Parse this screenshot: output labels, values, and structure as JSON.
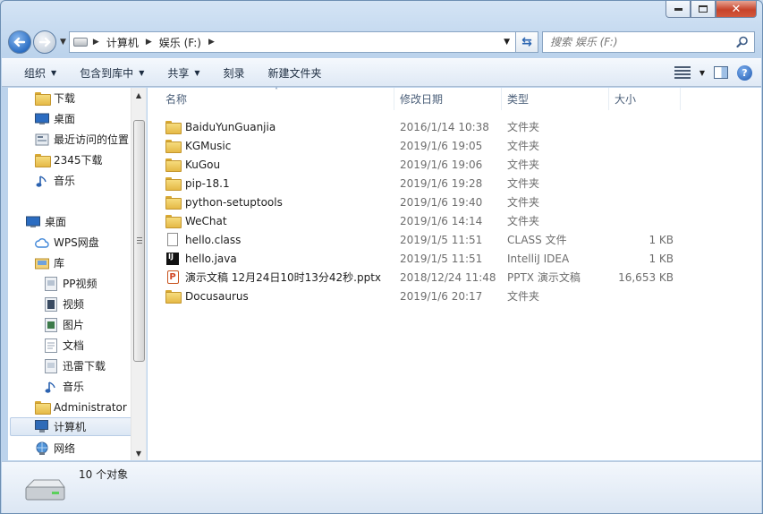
{
  "address": {
    "crumbs": [
      "计算机",
      "娱乐 (F:)"
    ],
    "search_placeholder": "搜索 娱乐 (F:)"
  },
  "toolbar": {
    "organize": "组织",
    "include_in_library": "包含到库中",
    "share": "共享",
    "burn": "刻录",
    "new_folder": "新建文件夹"
  },
  "nav": {
    "items": [
      {
        "label": "下载",
        "icon": "folder-icon"
      },
      {
        "label": "桌面",
        "icon": "desktop-icon"
      },
      {
        "label": "最近访问的位置",
        "icon": "recent-places-icon"
      },
      {
        "label": "2345下载",
        "icon": "folder-icon"
      },
      {
        "label": "音乐",
        "icon": "music-icon"
      },
      {
        "label": "桌面",
        "icon": "desktop-icon"
      },
      {
        "label": "WPS网盘",
        "icon": "cloud-icon"
      },
      {
        "label": "库",
        "icon": "library-icon"
      },
      {
        "label": "PP视频",
        "icon": "app-icon"
      },
      {
        "label": "视频",
        "icon": "video-icon"
      },
      {
        "label": "图片",
        "icon": "picture-icon"
      },
      {
        "label": "文档",
        "icon": "document-icon"
      },
      {
        "label": "迅雷下载",
        "icon": "app-icon"
      },
      {
        "label": "音乐",
        "icon": "music-icon"
      },
      {
        "label": "Administrator",
        "icon": "user-folder-icon"
      },
      {
        "label": "计算机",
        "icon": "computer-icon"
      },
      {
        "label": "网络",
        "icon": "network-icon"
      }
    ]
  },
  "columns": {
    "name": "名称",
    "date": "修改日期",
    "type": "类型",
    "size": "大小"
  },
  "files": [
    {
      "name": "BaiduYunGuanjia",
      "date": "2016/1/14 10:38",
      "type": "文件夹",
      "size": "",
      "icon": "folder-icon"
    },
    {
      "name": "KGMusic",
      "date": "2019/1/6 19:05",
      "type": "文件夹",
      "size": "",
      "icon": "folder-icon"
    },
    {
      "name": "KuGou",
      "date": "2019/1/6 19:06",
      "type": "文件夹",
      "size": "",
      "icon": "folder-icon"
    },
    {
      "name": "pip-18.1",
      "date": "2019/1/6 19:28",
      "type": "文件夹",
      "size": "",
      "icon": "folder-icon"
    },
    {
      "name": "python-setuptools",
      "date": "2019/1/6 19:40",
      "type": "文件夹",
      "size": "",
      "icon": "folder-icon"
    },
    {
      "name": "WeChat",
      "date": "2019/1/6 14:14",
      "type": "文件夹",
      "size": "",
      "icon": "folder-icon"
    },
    {
      "name": "hello.class",
      "date": "2019/1/5 11:51",
      "type": "CLASS 文件",
      "size": "1 KB",
      "icon": "file-icon"
    },
    {
      "name": "hello.java",
      "date": "2019/1/5 11:51",
      "type": "IntelliJ IDEA",
      "size": "1 KB",
      "icon": "intellij-icon"
    },
    {
      "name": "演示文稿 12月24日10时13分42秒.pptx",
      "date": "2018/12/24 11:48",
      "type": "PPTX 演示文稿",
      "size": "16,653 KB",
      "icon": "pptx-icon"
    },
    {
      "name": "Docusaurus",
      "date": "2019/1/6 20:17",
      "type": "文件夹",
      "size": "",
      "icon": "folder-icon"
    }
  ],
  "status": {
    "count": "10 个对象"
  }
}
